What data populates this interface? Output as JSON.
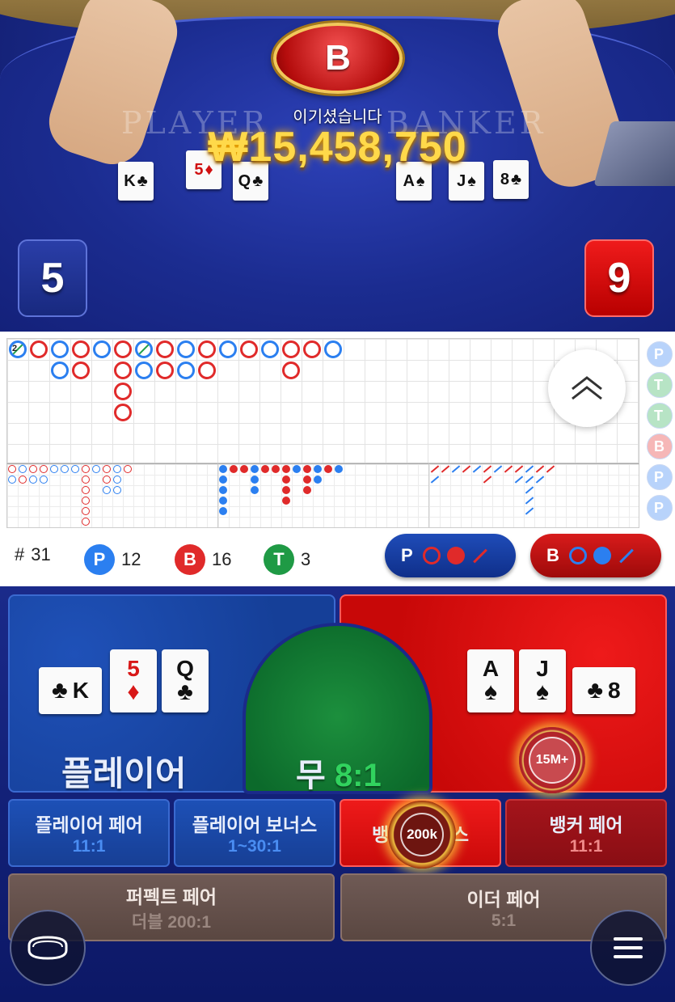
{
  "table": {
    "player_word": "PLAYER",
    "banker_word": "BANKER",
    "result_letter": "B",
    "win_message": "이기셨습니다",
    "win_amount": "₩15,458,750",
    "player_cards": [
      {
        "rank": "K",
        "suit": "♣",
        "color": "black"
      },
      {
        "rank": "5",
        "suit": "♦",
        "color": "red"
      },
      {
        "rank": "Q",
        "suit": "♣",
        "color": "black"
      }
    ],
    "banker_cards": [
      {
        "rank": "A",
        "suit": "♠",
        "color": "black"
      },
      {
        "rank": "J",
        "suit": "♠",
        "color": "black"
      },
      {
        "rank": "8",
        "suit": "♣",
        "color": "black"
      }
    ],
    "player_score": "5",
    "banker_score": "9"
  },
  "roadmap": {
    "big_road_columns": [
      [
        "P"
      ],
      [
        "B"
      ],
      [
        "P",
        "P"
      ],
      [
        "B",
        "B"
      ],
      [
        "P"
      ],
      [
        "B",
        "B",
        "B",
        "B"
      ],
      [
        "P",
        "P"
      ],
      [
        "B",
        "B"
      ],
      [
        "P",
        "P"
      ],
      [
        "B",
        "B"
      ],
      [
        "P"
      ],
      [
        "B"
      ],
      [
        "P"
      ],
      [
        "B",
        "B"
      ],
      [
        "B"
      ],
      [
        "P"
      ]
    ],
    "tie_count_label": "2",
    "side_roads": [
      "P",
      "T",
      "T",
      "B",
      "P",
      "P"
    ]
  },
  "stats": {
    "rounds_label": "#",
    "rounds": "31",
    "player_letter": "P",
    "player_count": "12",
    "banker_letter": "B",
    "banker_count": "16",
    "tie_letter": "T",
    "tie_count": "3"
  },
  "predict": {
    "player_label": "P",
    "banker_label": "B"
  },
  "bets": {
    "player": "플레이어",
    "tie": "무",
    "tie_odds": "8:1",
    "banker_chip": "15M+",
    "player_pair": "플레이어 페어",
    "player_pair_odds": "11:1",
    "player_bonus": "플레이어 보너스",
    "player_bonus_odds": "1~30:1",
    "banker_bonus_left": "뱅",
    "banker_bonus_right": "스",
    "banker_bonus_chip": "200k",
    "banker_pair": "뱅커 페어",
    "banker_pair_odds": "11:1",
    "perfect_pair": "퍼펙트 페어",
    "perfect_pair_odds": "더블 200:1",
    "either_pair": "이더 페어",
    "either_pair_odds": "5:1"
  },
  "colors": {
    "player_blue": "#2b7ff0",
    "banker_red": "#e02a2a",
    "tie_green": "#22a04a",
    "gold": "#ffd94a"
  }
}
